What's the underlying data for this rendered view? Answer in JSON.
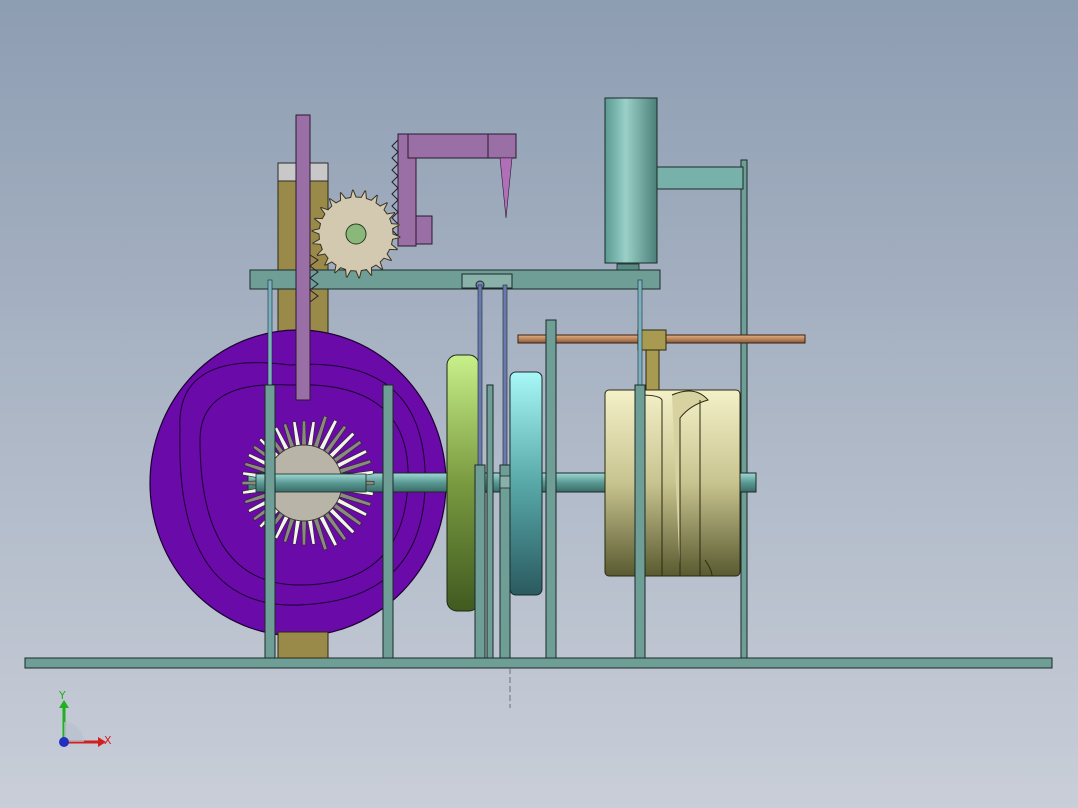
{
  "triad": {
    "y_label": "Y",
    "x_label": "X"
  },
  "colors": {
    "background_top": "#8d9db2",
    "background_bottom": "#c9ced8",
    "frame": "#6e9e96",
    "cam_disc": "#6a0aa8",
    "rack": "#9a6fa6",
    "column": "#9a8a4a",
    "gear": "#d2c9b0",
    "disc_green": "#a8c860",
    "disc_cyan": "#7ad8d8",
    "drum": "#e8e2b0",
    "cylinder": "#78b0aa",
    "copper_rod": "#c88a5a"
  }
}
